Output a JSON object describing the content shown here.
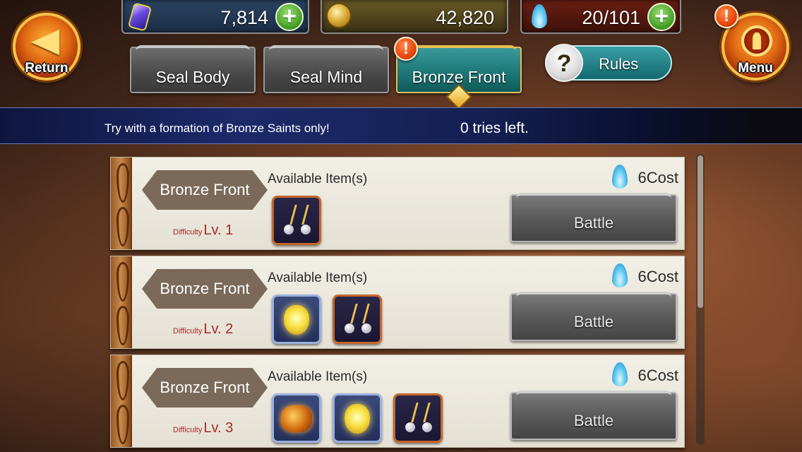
{
  "header": {
    "return_label": "Return",
    "menu_label": "Menu",
    "resources": {
      "gems": "7,814",
      "gold": "42,820",
      "cosmo": "20/101"
    },
    "plus_icon": "+",
    "alert_icon": "!"
  },
  "tabs": [
    {
      "label": "Seal Body",
      "active": false
    },
    {
      "label": "Seal Mind",
      "active": false
    },
    {
      "label": "Bronze Front",
      "active": true
    }
  ],
  "rules": {
    "label": "Rules",
    "icon": "?"
  },
  "strip": {
    "message": "Try with a formation of Bronze Saints only!",
    "tries": "0 tries left."
  },
  "stages": [
    {
      "name": "Bronze Front",
      "difficulty_label": "Difficulty",
      "level": "Lv. 1",
      "available_label": "Available Item(s)",
      "items": [
        "earring-icon"
      ],
      "cost": "6Cost",
      "battle_label": "Battle"
    },
    {
      "name": "Bronze Front",
      "difficulty_label": "Difficulty",
      "level": "Lv. 2",
      "available_label": "Available Item(s)",
      "items": [
        "crystal-icon",
        "earring-icon"
      ],
      "cost": "6Cost",
      "battle_label": "Battle"
    },
    {
      "name": "Bronze Front",
      "difficulty_label": "Difficulty",
      "level": "Lv. 3",
      "available_label": "Available Item(s)",
      "items": [
        "treasure-icon",
        "crystal-icon",
        "earring-icon"
      ],
      "cost": "6Cost",
      "battle_label": "Battle"
    }
  ],
  "colors": {
    "accent_teal": "#1e7878",
    "alert_orange": "#e8460c",
    "difficulty_red": "#a82a2a",
    "plus_green": "#3e9a1e"
  }
}
